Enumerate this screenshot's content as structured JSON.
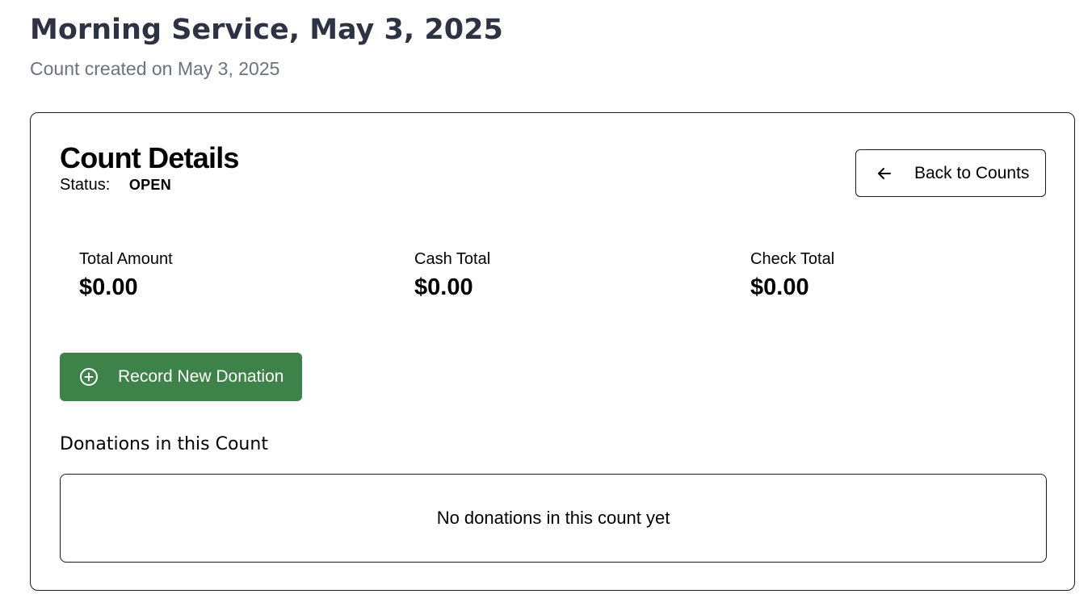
{
  "header": {
    "title": "Morning Service, May 3, 2025",
    "subtitle": "Count created on May 3, 2025"
  },
  "card": {
    "title": "Count Details",
    "status_label": "Status:",
    "status_value": "OPEN",
    "back_button_label": "Back to Counts",
    "back_button_icon": "arrow-left-icon",
    "stats": [
      {
        "label": "Total Amount",
        "value": "$0.00"
      },
      {
        "label": "Cash Total",
        "value": "$0.00"
      },
      {
        "label": "Check Total",
        "value": "$0.00"
      }
    ],
    "record_button_label": "Record New Donation",
    "record_button_icon": "plus-circle-icon",
    "record_button_color": "#3d8248",
    "donations_heading": "Donations in this Count",
    "empty_message": "No donations in this count yet"
  },
  "colors": {
    "title": "#2d3342",
    "subtitle": "#6b7280",
    "border": "#1a1a1a"
  }
}
